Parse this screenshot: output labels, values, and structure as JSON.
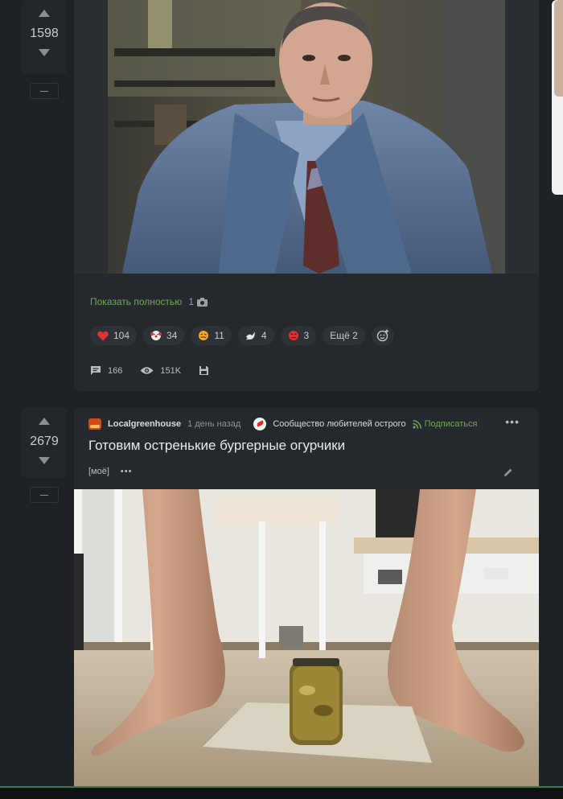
{
  "post1": {
    "score": "1598",
    "show_full": "Показать полностью",
    "photo_count": "1",
    "reactions": [
      {
        "icon": "heart-icon",
        "count": "104",
        "color": "#e0303a"
      },
      {
        "icon": "clown-face-icon",
        "count": "34",
        "color": "#ffffff"
      },
      {
        "icon": "woozy-face-icon",
        "count": "11",
        "color": "#f5a623"
      },
      {
        "icon": "dove-icon",
        "count": "4",
        "color": "#e6e6e6"
      },
      {
        "icon": "angry-face-icon",
        "count": "3",
        "color": "#e0303a"
      }
    ],
    "more_reactions": "Ещё 2",
    "comments": "166",
    "views": "151K"
  },
  "post2": {
    "score": "2679",
    "author": "Localgreenhouse",
    "time": "1 день назад",
    "community": "Сообщество любителей острого",
    "subscribe": "Подписаться",
    "title": "Готовим остренькие бургерные огурчики",
    "tag": "[моё]"
  },
  "colors": {
    "background": "#1e2226",
    "card": "#25292e",
    "accent_green": "#6fa85a"
  }
}
